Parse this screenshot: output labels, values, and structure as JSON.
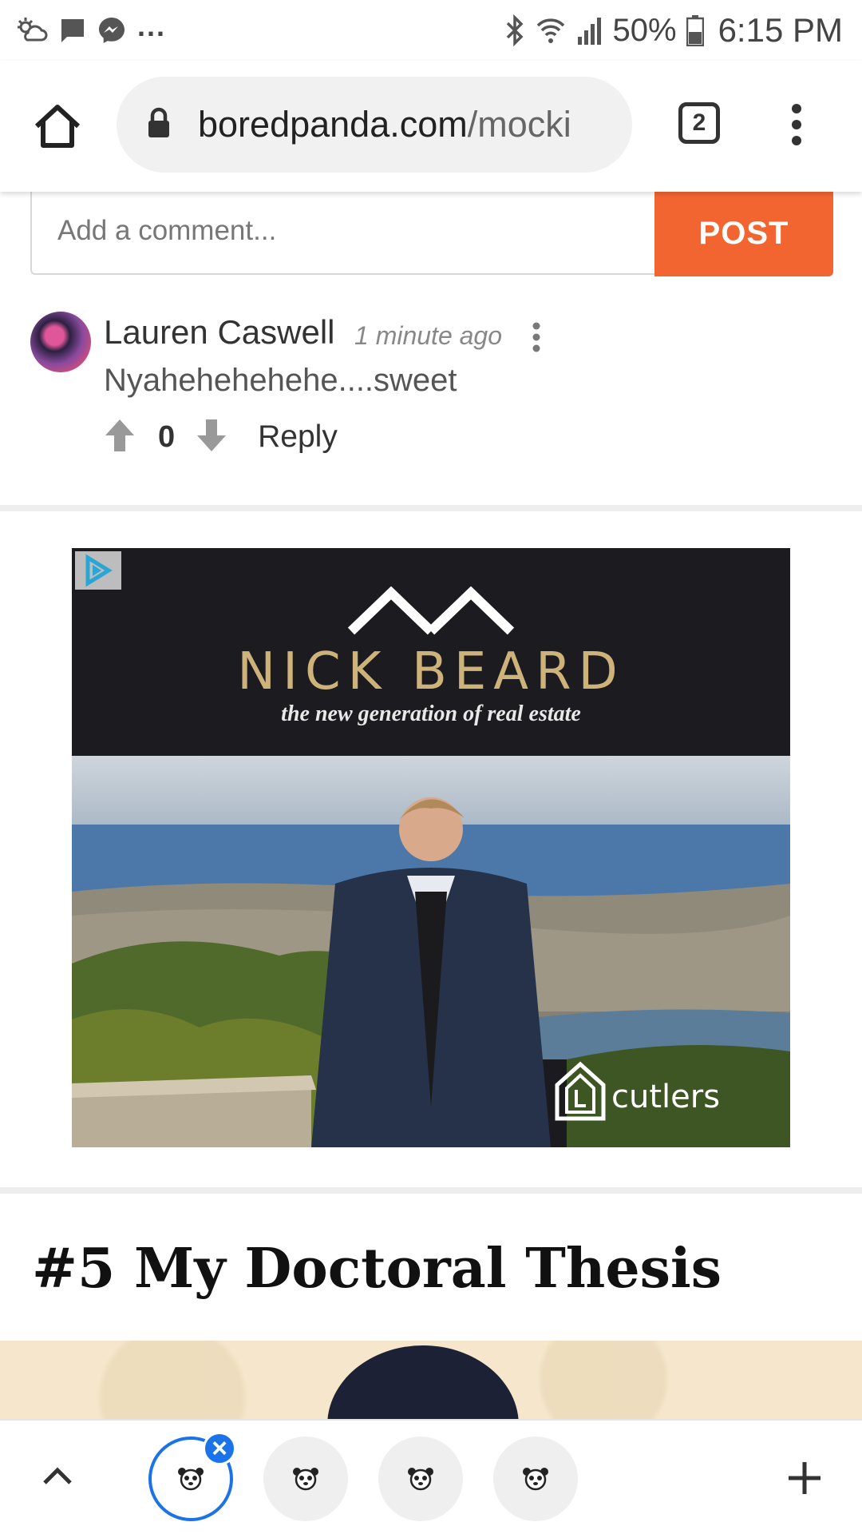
{
  "status_bar": {
    "overflow_dots": "...",
    "battery_percent": "50%",
    "time": "6:15 PM",
    "icons": [
      "weather-icon",
      "message-icon",
      "messenger-icon",
      "bluetooth-icon",
      "wifi-icon",
      "signal-icon",
      "battery-icon"
    ]
  },
  "browser": {
    "url_host": "boredpanda.com",
    "url_path": "/mocki",
    "tab_count": "2",
    "icons": [
      "home-icon",
      "lock-icon",
      "menu-icon"
    ]
  },
  "comments": {
    "input_placeholder": "Add a comment...",
    "post_label": "POST",
    "items": [
      {
        "author": "Lauren Caswell",
        "time": "1 minute ago",
        "text": "Nyahehehehehe....sweet",
        "votes": "0",
        "reply_label": "Reply"
      }
    ]
  },
  "ad": {
    "brand": "NICK BEARD",
    "tagline": "the new generation of real estate",
    "agency": "cutlers"
  },
  "article": {
    "title": "#5 My Doctoral Thesis"
  },
  "tab_strip": {
    "tabs": [
      "panda-favicon",
      "panda-favicon",
      "panda-favicon",
      "panda-favicon"
    ],
    "active_index": 0,
    "accent": "#1a73e8"
  },
  "colors": {
    "post_button": "#f26531",
    "ad_gold": "#cdb27a"
  }
}
